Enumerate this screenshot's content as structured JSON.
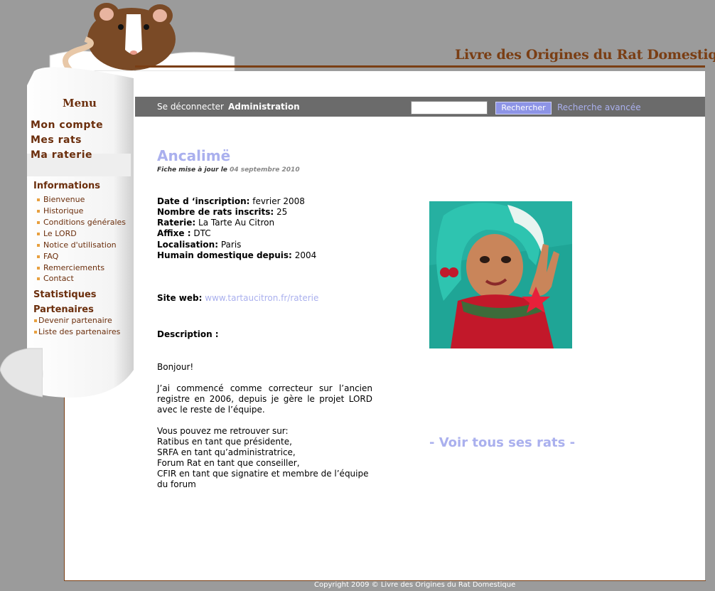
{
  "header": {
    "site_title": "Livre des Origines du Rat Domestique"
  },
  "toolbar": {
    "logout_label": "Se déconnecter",
    "admin_label": "Administration",
    "search_value": "",
    "search_button": "Rechercher",
    "advanced_search": "Recherche avancée"
  },
  "sidebar": {
    "menu_title": "Menu",
    "main_links": [
      "Mon compte",
      "Mes rats",
      "Ma raterie"
    ],
    "informations": {
      "title": "Informations",
      "items": [
        "Bienvenue",
        "Historique",
        "Conditions générales",
        "Le LORD",
        "Notice d'utilisation",
        "FAQ",
        "Remerciements",
        "Contact"
      ]
    },
    "statistiques": "Statistiques",
    "partenaires": {
      "title": "Partenaires",
      "items": [
        "Devenir partenaire",
        "Liste des partenaires"
      ]
    }
  },
  "profile": {
    "name": "Ancalimë",
    "updated_prefix": "Fiche mise à jour le",
    "updated_date": "04 septembre 2010",
    "fields": [
      {
        "label": "Date d ‘inscription:",
        "value": " fevrier 2008"
      },
      {
        "label": "Nombre de rats inscrits:",
        "value": "25"
      },
      {
        "label": "Raterie:",
        "value": "La Tarte Au Citron"
      },
      {
        "label": "Affixe :",
        "value": "DTC"
      },
      {
        "label": "Localisation:",
        "value": "Paris"
      },
      {
        "label": "Humain domestique depuis:",
        "value": "2004"
      }
    ],
    "website_label": "Site web:",
    "website": "www.tartaucitron.fr/raterie",
    "description_label": "Description :",
    "description": [
      "Bonjour!",
      "J’ai commencé comme correcteur sur l’ancien registre en 2006, depuis je gère le projet LORD avec le reste de l’équipe.",
      "Vous pouvez me retrouver sur:\nRatibus en tant que présidente,\nSRFA en tant qu’administratrice,\nForum Rat en tant que conseiller,\nCFIR en tant que signatire et membre de l’équipe du forum"
    ],
    "see_all_rats": "- Voir tous ses rats -"
  },
  "footer": {
    "copyright": "Copyright 2009 © Livre des Origines du Rat Domestique"
  },
  "colors": {
    "brown": "#6b2e0c",
    "accent_blue": "#aab0ee",
    "toolbar_gray": "#6b6b6b",
    "background": "#9b9b9b"
  }
}
